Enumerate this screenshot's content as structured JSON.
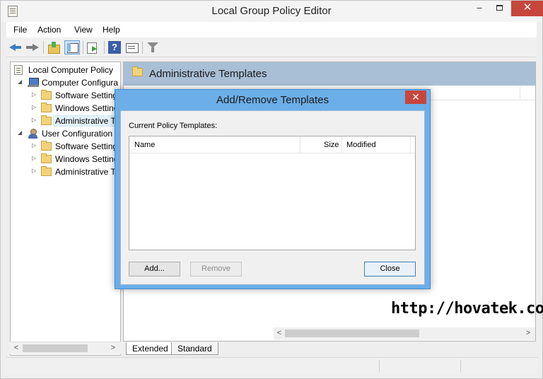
{
  "window": {
    "title": "Local Group Policy Editor",
    "min_glyph": "–",
    "close_glyph": "✕"
  },
  "menu": [
    "File",
    "Action",
    "View",
    "Help"
  ],
  "toolbar": {
    "icons": [
      "back-arrow-icon",
      "forward-arrow-icon",
      "up-one-level-icon",
      "show-hide-console-tree-icon",
      "export-list-icon",
      "help-icon",
      "properties-icon",
      "filter-icon"
    ],
    "help_glyph": "?"
  },
  "tree": {
    "root": "Local Computer Policy",
    "computer": "Computer Configura",
    "computer_children": [
      "Software Setting",
      "Windows Setting",
      "Administrative T"
    ],
    "user": "User Configuration",
    "user_children": [
      "Software Setting",
      "Windows Setting",
      "Administrative T"
    ],
    "expanded_glyph": "◢",
    "collapsed_glyph": "▷"
  },
  "right_pane": {
    "title": "Administrative Templates"
  },
  "tabs": [
    "Extended",
    "Standard"
  ],
  "scroll": {
    "left_glyph": "<",
    "right_glyph": ">"
  },
  "dialog": {
    "title": "Add/Remove Templates",
    "close_glyph": "✕",
    "list_label": "Current Policy Templates:",
    "columns": [
      "Name",
      "Size",
      "Modified"
    ],
    "rows": [],
    "buttons": {
      "add": "Add...",
      "remove": "Remove",
      "close": "Close"
    }
  },
  "watermark": "http://hovatek.com",
  "colors": {
    "dialog_frame": "#6caee8",
    "close_button": "#c7463c",
    "pane_header": "#a9bfd6"
  }
}
